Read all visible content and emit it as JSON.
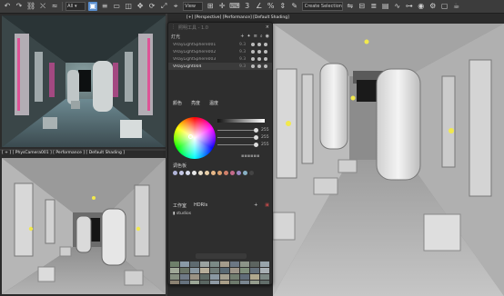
{
  "toolbar": {
    "undo_icon": "undo-icon",
    "redo_icon": "redo-icon",
    "view_dropdown": "View",
    "selection_set": "Create Selection Se"
  },
  "viewports": {
    "camera": {
      "label": "[ + ] [ PhysCamera001 ] [ Performance ] [ Default Shading ]"
    },
    "perspective": {
      "label": "[+] [Perspective] [Performance] [Default Shading]"
    }
  },
  "panel": {
    "title": "照明工具 - 1.0",
    "lights_header": "灯光",
    "lights": [
      {
        "name": "VRayLightSphere001",
        "val": "9.3",
        "selected": false
      },
      {
        "name": "VRayLightSphere002",
        "val": "9.3",
        "selected": false
      },
      {
        "name": "VRayLightSphere003",
        "val": "9.3",
        "selected": false
      },
      {
        "name": "VRayLight004",
        "val": "9.3",
        "selected": true
      }
    ],
    "tabs": [
      "颜色",
      "亮度",
      "温度"
    ],
    "values": [
      "255",
      "255",
      "255"
    ],
    "preset_header": "调色板",
    "tabs2": [
      "工作室",
      "HDRIs"
    ],
    "folder": "studios"
  }
}
